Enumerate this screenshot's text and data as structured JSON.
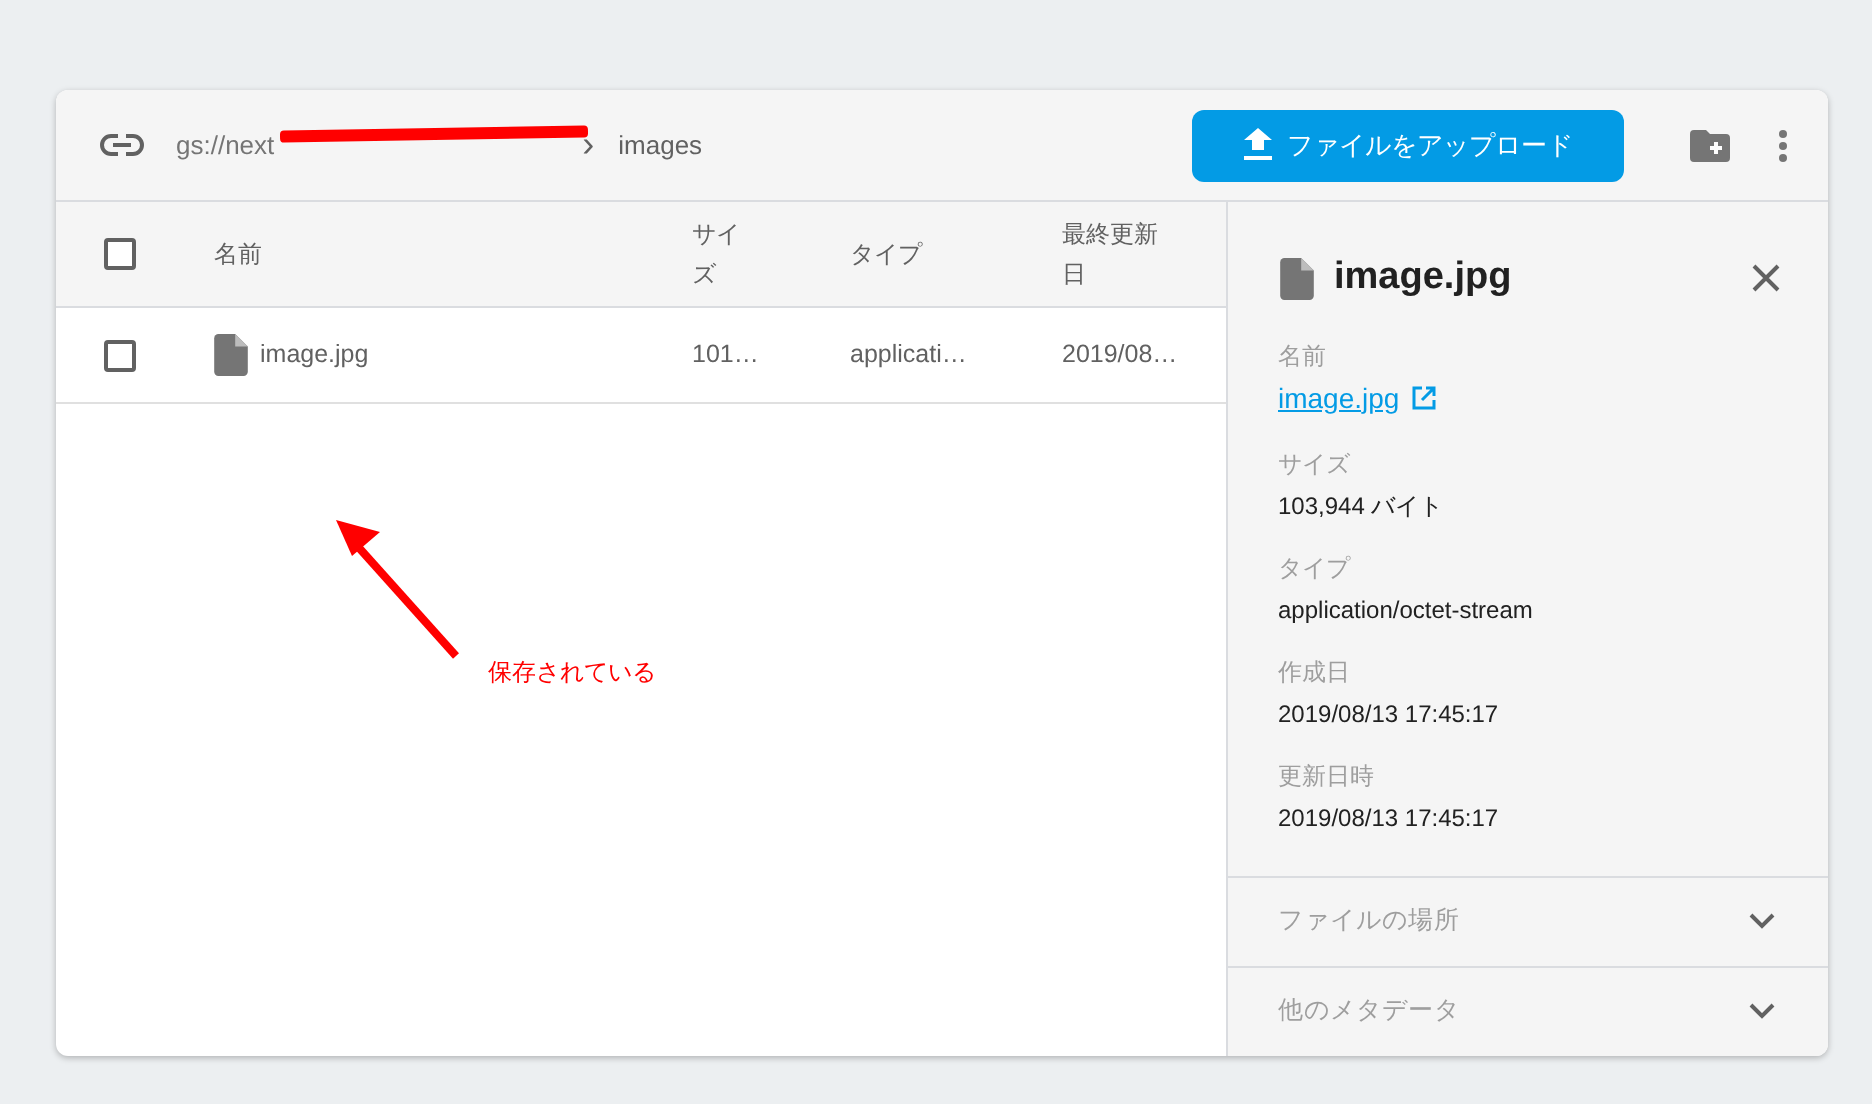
{
  "header": {
    "path": "gs://next",
    "separator": "›",
    "folder": "images",
    "upload_button": "ファイルをアップロード"
  },
  "table": {
    "select_all": {
      "checked": false
    },
    "columns": [
      "名前",
      "サイズ",
      "タイプ",
      "最終更新日"
    ],
    "rows": [
      {
        "checked": false,
        "name": "image.jpg",
        "size": "101…",
        "type": "applicati…",
        "modified": "2019/08…"
      }
    ]
  },
  "annotation": {
    "text": "保存されている"
  },
  "details": {
    "title": "image.jpg",
    "fields": [
      {
        "label": "名前",
        "value": "image.jpg",
        "kind": "link"
      },
      {
        "label": "サイズ",
        "value": "103,944 バイト",
        "kind": "text"
      },
      {
        "label": "タイプ",
        "value": "application/octet-stream",
        "kind": "text"
      },
      {
        "label": "作成日",
        "value": "2019/08/13 17:45:17",
        "kind": "text"
      },
      {
        "label": "更新日時",
        "value": "2019/08/13 17:45:17",
        "kind": "text"
      }
    ],
    "sections": [
      {
        "label": "ファイルの場所",
        "expanded": false
      },
      {
        "label": "他のメタデータ",
        "expanded": false
      }
    ]
  }
}
